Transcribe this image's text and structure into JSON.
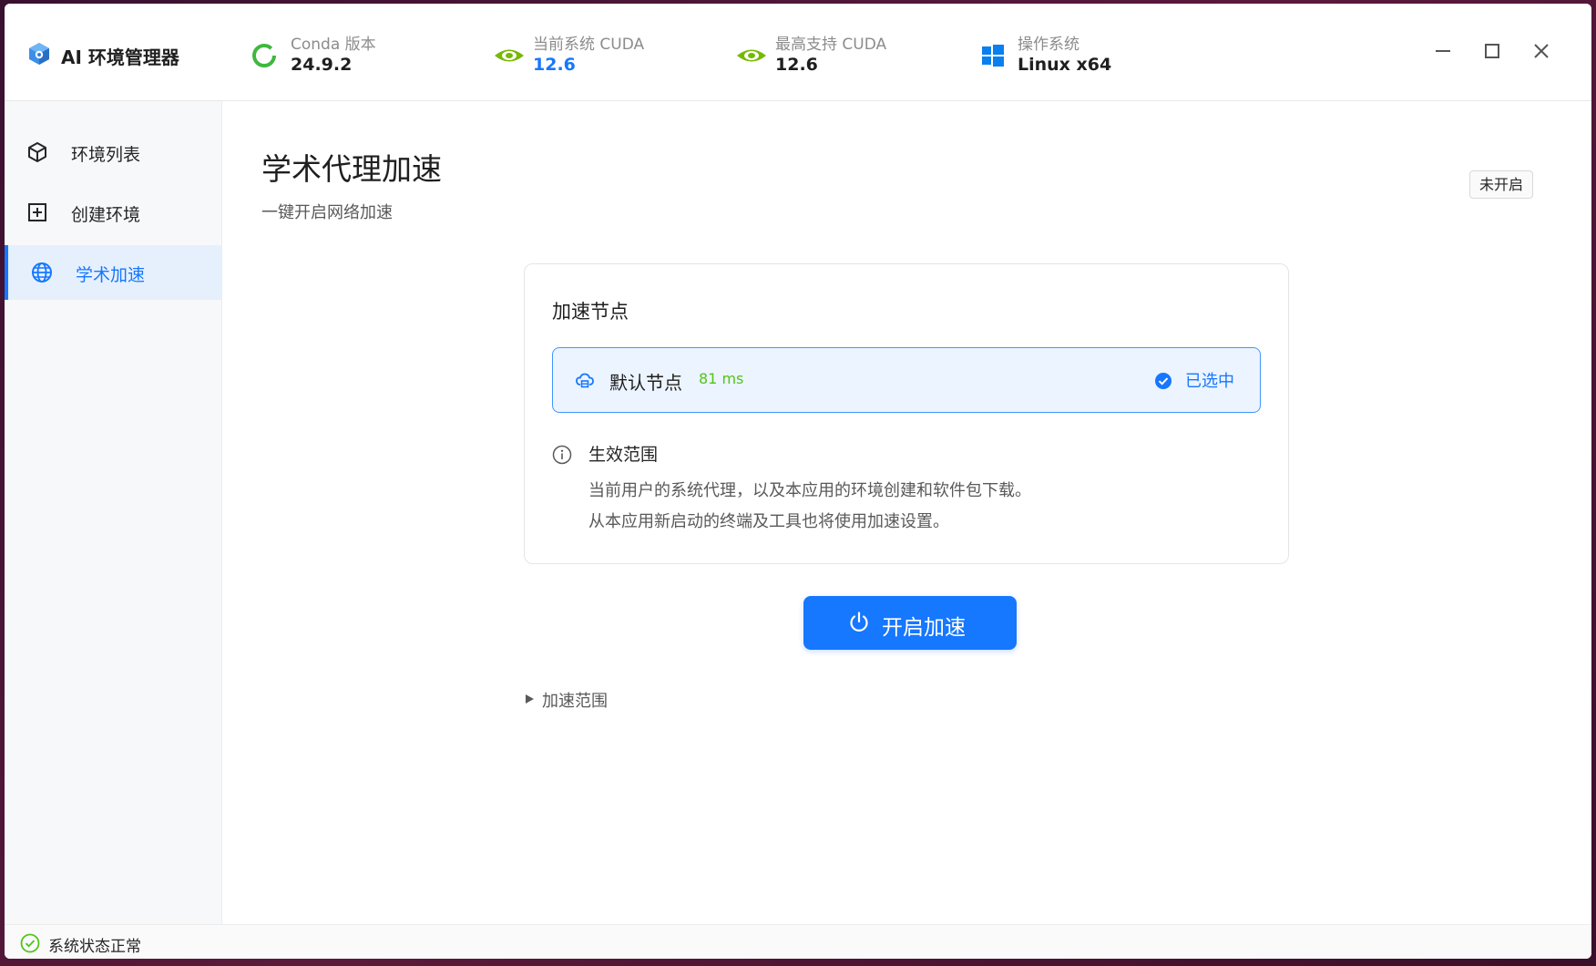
{
  "app": {
    "title": "AI 环境管理器"
  },
  "header": {
    "conda": {
      "label": "Conda 版本",
      "value": "24.9.2"
    },
    "current_cuda": {
      "label": "当前系统 CUDA",
      "value": "12.6"
    },
    "max_cuda": {
      "label": "最高支持 CUDA",
      "value": "12.6"
    },
    "os": {
      "label": "操作系统",
      "value": "Linux x64"
    }
  },
  "sidebar": {
    "items": [
      {
        "label": "环境列表",
        "icon": "cube-icon"
      },
      {
        "label": "创建环境",
        "icon": "plus-square-icon"
      },
      {
        "label": "学术加速",
        "icon": "globe-icon",
        "active": true
      }
    ]
  },
  "main": {
    "title": "学术代理加速",
    "subtitle": "一键开启网络加速",
    "status_badge": "未开启",
    "card": {
      "title": "加速节点",
      "node": {
        "name": "默认节点",
        "latency": "81 ms",
        "selected_label": "已选中"
      },
      "scope": {
        "title": "生效范围",
        "line1": "当前用户的系统代理，以及本应用的环境创建和软件包下载。",
        "line2": "从本应用新启动的终端及工具也将使用加速设置。"
      }
    },
    "start_button": "开启加速",
    "expander": "加速范围"
  },
  "statusbar": {
    "text": "系统状态正常"
  },
  "colors": {
    "accent": "#1677ff",
    "success": "#52c41a",
    "nvidia": "#76b900",
    "windows": "#0a7ff0"
  }
}
